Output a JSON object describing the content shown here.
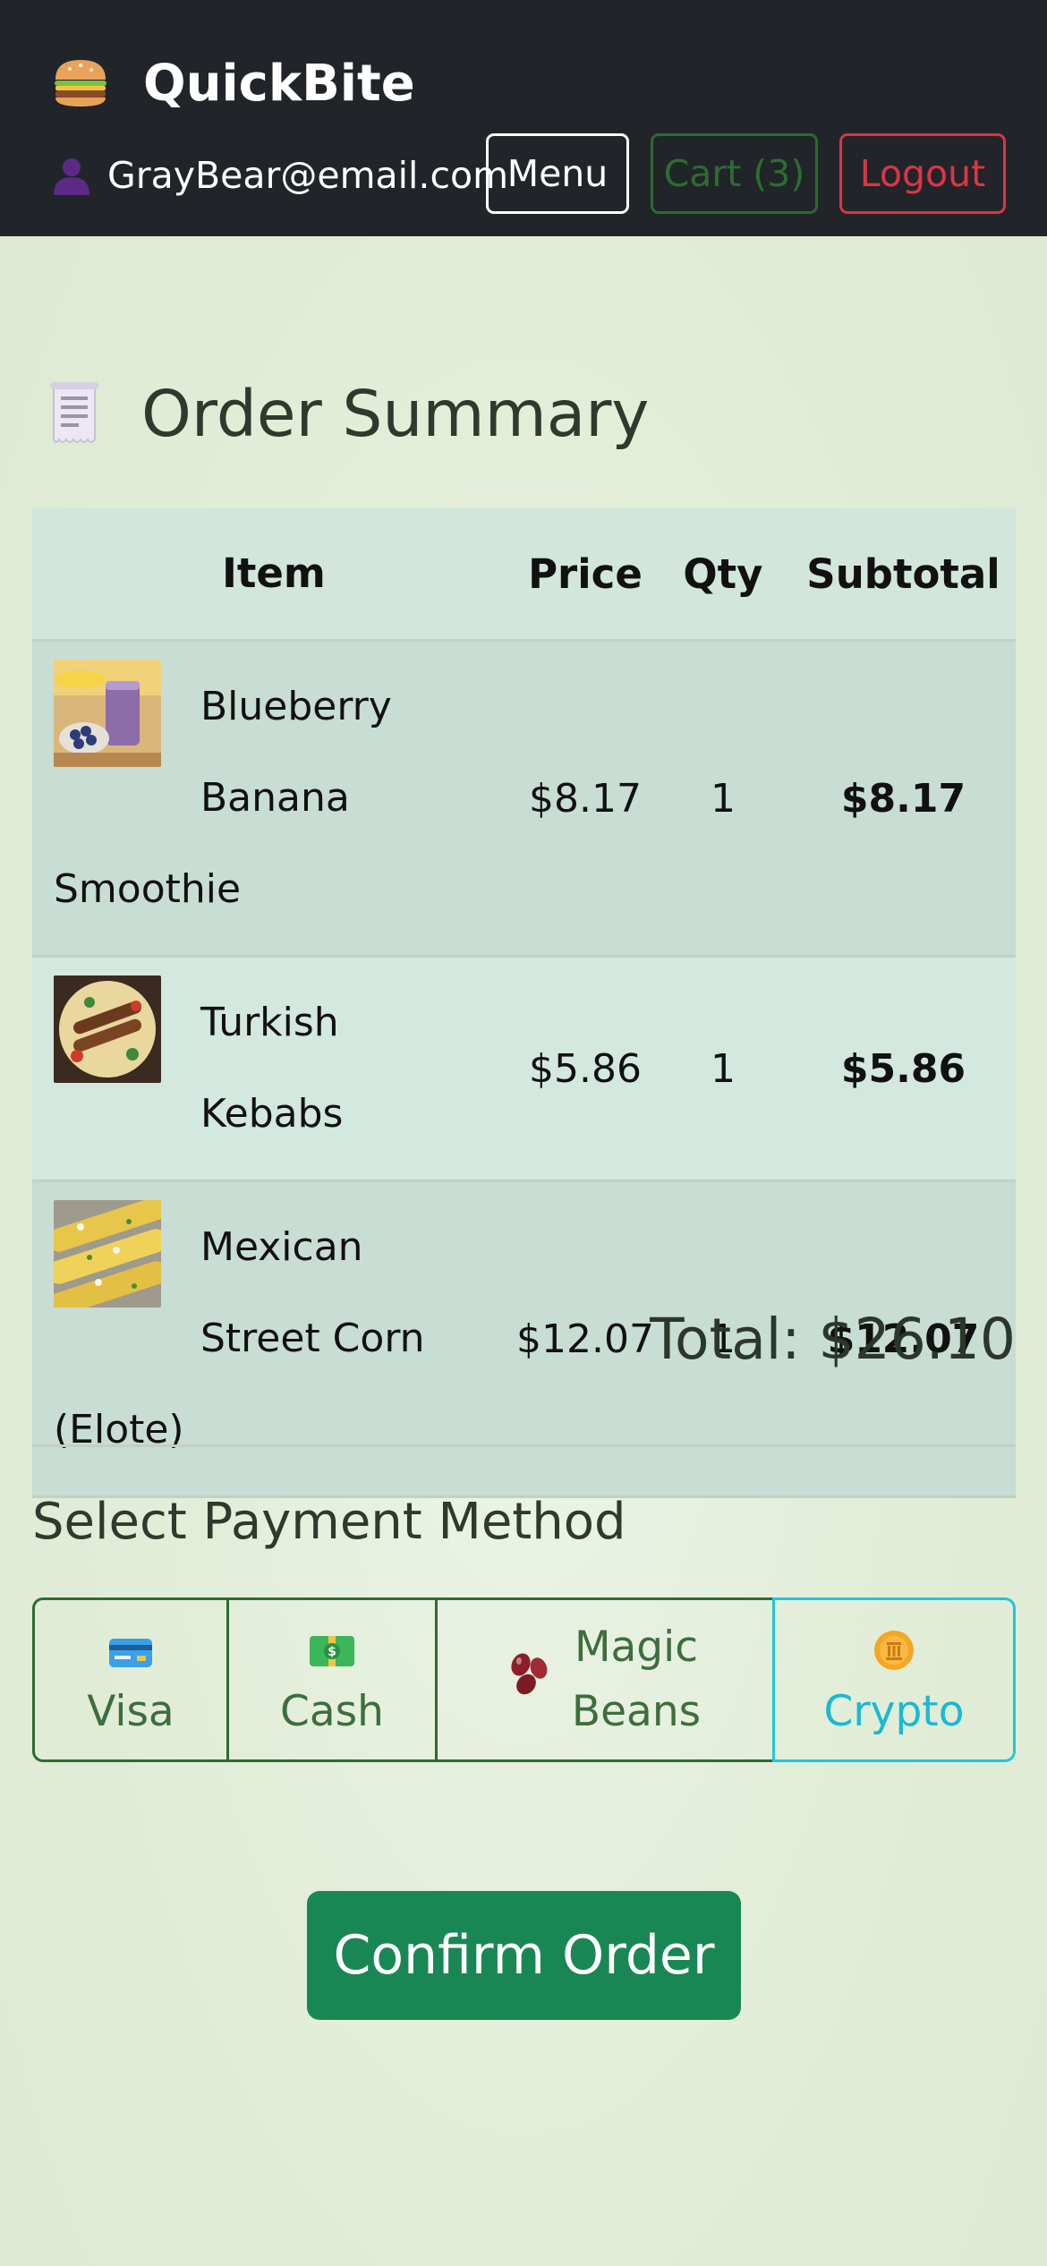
{
  "navbar": {
    "brand": "QuickBite",
    "brand_icon": "hamburger-icon",
    "user_icon": "user-silhouette-icon",
    "user_email": "GrayBear@email.com",
    "menu_label": "Menu",
    "cart_label": "Cart (3)",
    "logout_label": "Logout"
  },
  "page": {
    "title": "Order Summary",
    "title_icon": "receipt-icon"
  },
  "table": {
    "headers": [
      "Item",
      "Price",
      "Qty",
      "Subtotal"
    ],
    "rows": [
      {
        "name": "Blueberry Banana Smoothie",
        "price": "$8.17",
        "qty": "1",
        "subtotal": "$8.17",
        "image": "smoothie-image"
      },
      {
        "name": "Turkish Kebabs",
        "price": "$5.86",
        "qty": "1",
        "subtotal": "$5.86",
        "image": "kebabs-image"
      },
      {
        "name": "Mexican Street Corn (Elote)",
        "price": "$12.07",
        "qty": "1",
        "subtotal": "$12.07",
        "image": "elote-image"
      }
    ]
  },
  "total_label": "Total: $26.10",
  "payment": {
    "title": "Select Payment Method",
    "options": [
      {
        "label": "Visa",
        "icon": "credit-card-icon"
      },
      {
        "label": "Cash",
        "icon": "dollar-bill-icon"
      },
      {
        "label": "Magic Beans",
        "icon": "beans-icon"
      },
      {
        "label": "Crypto",
        "icon": "coin-icon"
      }
    ]
  },
  "confirm_label": "Confirm Order",
  "colors": {
    "navbar_bg": "#212529",
    "primary_green": "#198754",
    "danger": "#dc3545",
    "info": "#1fc6dc",
    "page_bg": "#e3eed9"
  }
}
